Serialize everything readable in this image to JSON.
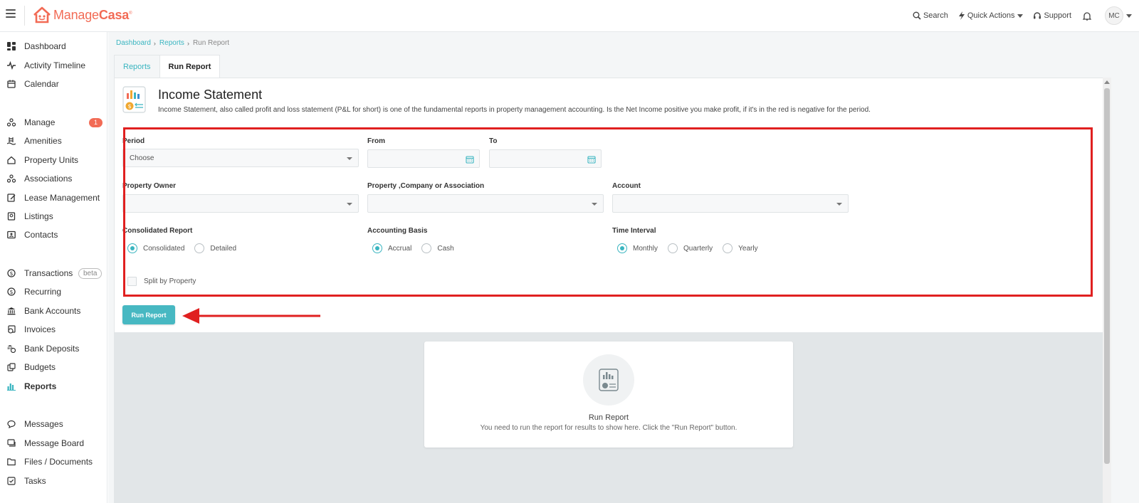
{
  "app": {
    "logo": {
      "manage": "Manage",
      "casa": "Casa",
      "reg": "®"
    }
  },
  "topbar": {
    "search": "Search",
    "quick_actions": "Quick Actions",
    "support": "Support",
    "avatar": "MC"
  },
  "sidebar": {
    "items": [
      {
        "label": "Dashboard",
        "icon": "dashboard-icon"
      },
      {
        "label": "Activity Timeline",
        "icon": "activity-icon"
      },
      {
        "label": "Calendar",
        "icon": "calendar-icon"
      },
      {
        "label": "Manage",
        "icon": "manage-icon",
        "badge": "1"
      },
      {
        "label": "Amenities",
        "icon": "amenities-icon"
      },
      {
        "label": "Property Units",
        "icon": "home-icon"
      },
      {
        "label": "Associations",
        "icon": "associations-icon"
      },
      {
        "label": "Lease Management",
        "icon": "lease-icon"
      },
      {
        "label": "Listings",
        "icon": "listings-icon"
      },
      {
        "label": "Contacts",
        "icon": "contacts-icon"
      },
      {
        "label": "Transactions",
        "icon": "transactions-icon",
        "tag": "beta"
      },
      {
        "label": "Recurring",
        "icon": "recurring-icon"
      },
      {
        "label": "Bank Accounts",
        "icon": "bank-icon"
      },
      {
        "label": "Invoices",
        "icon": "invoices-icon"
      },
      {
        "label": "Bank Deposits",
        "icon": "deposits-icon"
      },
      {
        "label": "Budgets",
        "icon": "budgets-icon"
      },
      {
        "label": "Reports",
        "icon": "reports-icon",
        "active": true
      },
      {
        "label": "Messages",
        "icon": "messages-icon"
      },
      {
        "label": "Message Board",
        "icon": "message-board-icon"
      },
      {
        "label": "Files / Documents",
        "icon": "folder-icon"
      },
      {
        "label": "Tasks",
        "icon": "tasks-icon"
      }
    ]
  },
  "breadcrumb": [
    "Dashboard",
    "Reports",
    "Run Report"
  ],
  "tabs": [
    {
      "label": "Reports",
      "active": false
    },
    {
      "label": "Run Report",
      "active": true
    }
  ],
  "report": {
    "title": "Income Statement",
    "description": "Income Statement, also called profit and loss statement (P&L for short) is one of the fundamental reports in property management accounting. Is the Net Income positive you make profit, if it's in the red is negative for the period."
  },
  "form": {
    "period": {
      "label": "Period",
      "value": "Choose"
    },
    "from": {
      "label": "From",
      "value": ""
    },
    "to": {
      "label": "To",
      "value": ""
    },
    "property_owner": {
      "label": "Property Owner",
      "value": ""
    },
    "property_company": {
      "label": "Property ,Company or Association",
      "value": ""
    },
    "account": {
      "label": "Account",
      "value": ""
    },
    "consolidated_report": {
      "label": "Consolidated Report",
      "options": [
        "Consolidated",
        "Detailed"
      ],
      "selected": "Consolidated"
    },
    "accounting_basis": {
      "label": "Accounting Basis",
      "options": [
        "Accrual",
        "Cash"
      ],
      "selected": "Accrual"
    },
    "time_interval": {
      "label": "Time Interval",
      "options": [
        "Monthly",
        "Quarterly",
        "Yearly"
      ],
      "selected": "Monthly"
    },
    "split_by_property": {
      "label": "Split by Property",
      "checked": false
    }
  },
  "run_button": "Run Report",
  "empty_state": {
    "title": "Run Report",
    "message": "You need to run the report for results to show here. Click the \"Run Report\" button."
  },
  "colors": {
    "accent": "#3ab5c0",
    "brand": "#f26b55",
    "highlight": "#e02020"
  }
}
